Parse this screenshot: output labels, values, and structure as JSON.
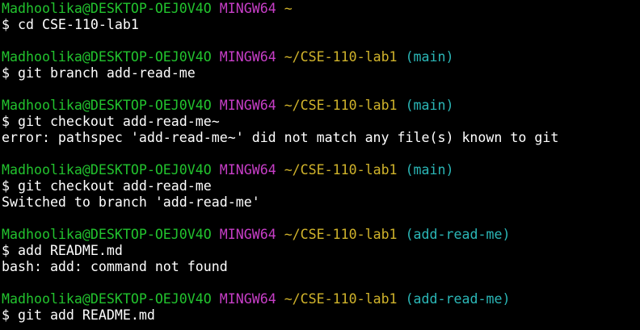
{
  "colors": {
    "background": "#000000",
    "user_host": "#22c32e",
    "mingw": "#c73ec7",
    "path": "#d0b32b",
    "branch": "#2bb7b7",
    "text": "#ffffff"
  },
  "blocks": [
    {
      "prompt": {
        "user_host": "Madhoolika@DESKTOP-OEJ0V4O",
        "env": "MINGW64",
        "path": "~",
        "branch": ""
      },
      "command": "$ cd CSE-110-lab1",
      "output": []
    },
    {
      "prompt": {
        "user_host": "Madhoolika@DESKTOP-OEJ0V4O",
        "env": "MINGW64",
        "path": "~/CSE-110-lab1",
        "branch": "(main)"
      },
      "command": "$ git branch add-read-me",
      "output": []
    },
    {
      "prompt": {
        "user_host": "Madhoolika@DESKTOP-OEJ0V4O",
        "env": "MINGW64",
        "path": "~/CSE-110-lab1",
        "branch": "(main)"
      },
      "command": "$ git checkout add-read-me~",
      "output": [
        "error: pathspec 'add-read-me~' did not match any file(s) known to git"
      ]
    },
    {
      "prompt": {
        "user_host": "Madhoolika@DESKTOP-OEJ0V4O",
        "env": "MINGW64",
        "path": "~/CSE-110-lab1",
        "branch": "(main)"
      },
      "command": "$ git checkout add-read-me",
      "output": [
        "Switched to branch 'add-read-me'"
      ]
    },
    {
      "prompt": {
        "user_host": "Madhoolika@DESKTOP-OEJ0V4O",
        "env": "MINGW64",
        "path": "~/CSE-110-lab1",
        "branch": "(add-read-me)"
      },
      "command": "$ add README.md",
      "output": [
        "bash: add: command not found"
      ]
    },
    {
      "prompt": {
        "user_host": "Madhoolika@DESKTOP-OEJ0V4O",
        "env": "MINGW64",
        "path": "~/CSE-110-lab1",
        "branch": "(add-read-me)"
      },
      "command": "$ git add README.md",
      "output": []
    }
  ]
}
